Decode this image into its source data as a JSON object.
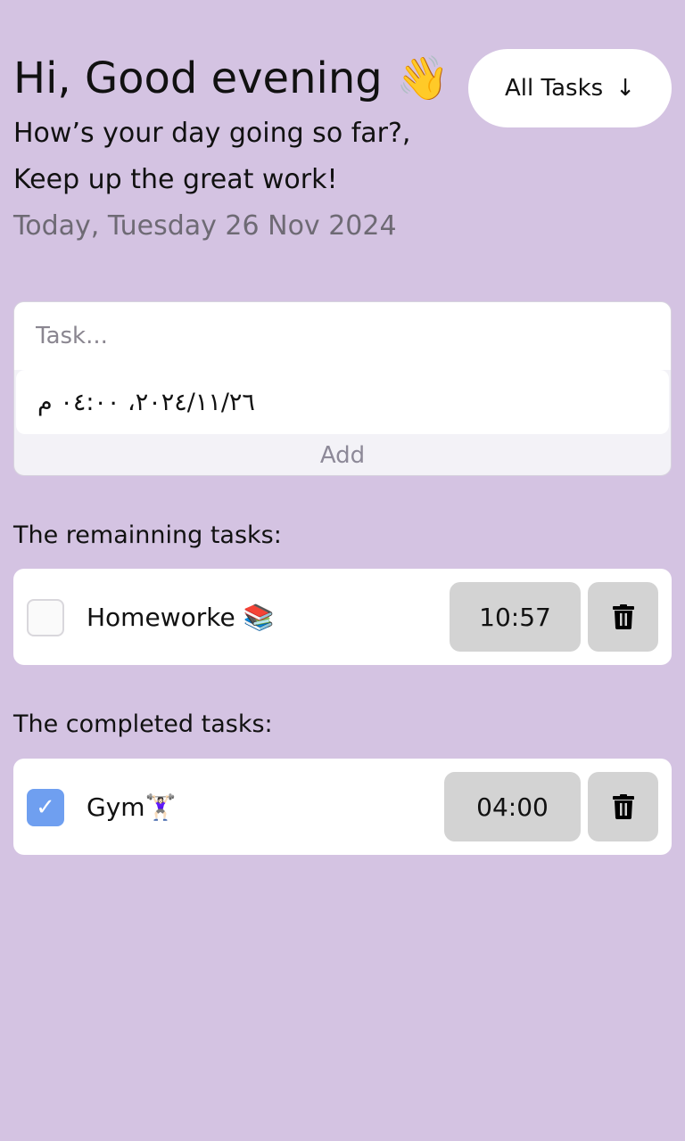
{
  "header": {
    "greeting": "Hi, Good evening 👋",
    "line1": "How’s your day going so far?,",
    "line2": "Keep up the great work!",
    "date": "Today, Tuesday 26 Nov 2024"
  },
  "filter": {
    "label": "All Tasks",
    "icon": "↓"
  },
  "form": {
    "task_placeholder": "Task...",
    "datetime_value": "٢٠٢٤/١١/٢٦، ٠٤:٠٠ م",
    "add_label": "Add"
  },
  "remaining": {
    "title": "The remainning tasks:",
    "tasks": [
      {
        "name": "Homeworke 📚",
        "time": "10:57",
        "completed": false
      }
    ]
  },
  "completed": {
    "title": "The completed tasks:",
    "tasks": [
      {
        "name": "Gym🏋🏻‍♀️",
        "time": "04:00",
        "completed": true
      }
    ]
  },
  "colors": {
    "background": "#d4c3e2",
    "checked": "#6f9ff0",
    "button_gray": "#d3d3d3"
  }
}
